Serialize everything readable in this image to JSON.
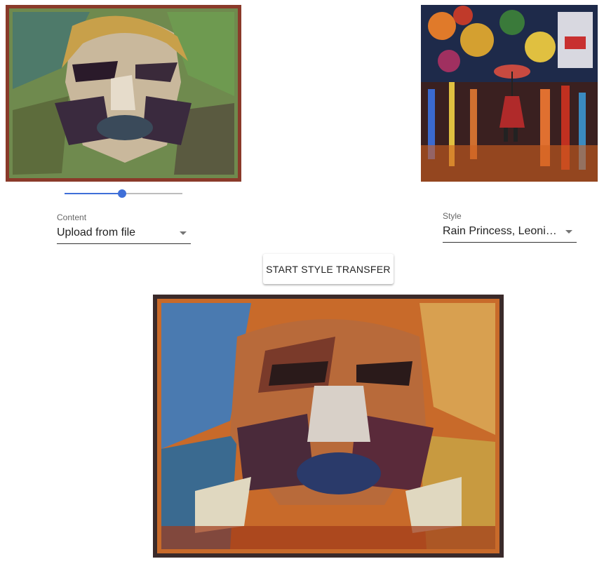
{
  "content_image": {
    "icon": "stylized-portrait-image"
  },
  "style_image": {
    "icon": "rain-princess-painting-image"
  },
  "output_image": {
    "icon": "styled-output-image"
  },
  "style_strength_slider": {
    "value_fraction": 0.49
  },
  "content_select": {
    "label": "Content",
    "value": "Upload from file"
  },
  "style_select": {
    "label": "Style",
    "value": "Rain Princess, Leonid ..."
  },
  "transfer_button": {
    "label": "START STYLE TRANSFER"
  },
  "colors": {
    "accent": "#3f6fd8"
  }
}
